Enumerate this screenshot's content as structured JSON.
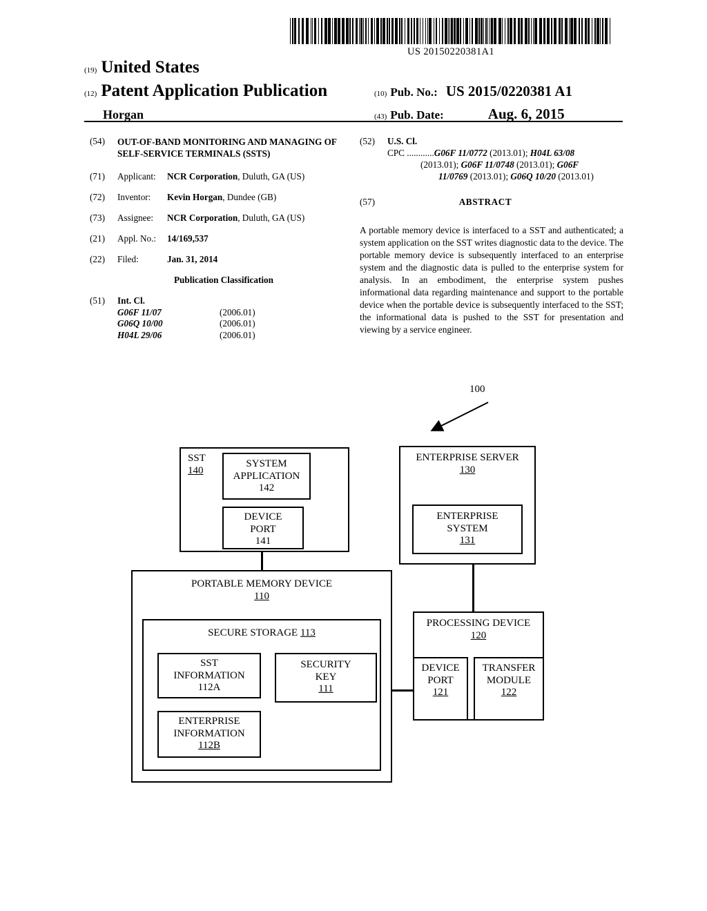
{
  "barcode": {
    "number": "US 20150220381A1"
  },
  "masthead": {
    "inid_19": "(19)",
    "country": "United States",
    "inid_12": "(12)",
    "doc_type": "Patent Application Publication",
    "author": "Horgan",
    "inid_10": "(10)",
    "pubno_label": "Pub. No.:",
    "pubno_value": "US 2015/0220381 A1",
    "inid_43": "(43)",
    "pubdate_label": "Pub. Date:",
    "pubdate_value": "Aug. 6, 2015"
  },
  "left_column": {
    "title": {
      "code": "(54)",
      "text": "OUT-OF-BAND MONITORING AND MANAGING OF SELF-SERVICE TERMINALS (SSTS)"
    },
    "applicant": {
      "code": "(71)",
      "label": "Applicant:",
      "name": "NCR Corporation",
      "rest": ", Duluth, GA (US)"
    },
    "inventor": {
      "code": "(72)",
      "label": "Inventor:",
      "name": "Kevin Horgan",
      "rest": ", Dundee (GB)"
    },
    "assignee": {
      "code": "(73)",
      "label": "Assignee:",
      "name": "NCR Corporation",
      "rest": ", Duluth, GA (US)"
    },
    "appl_no": {
      "code": "(21)",
      "label": "Appl. No.:",
      "value": "14/169,537"
    },
    "filed": {
      "code": "(22)",
      "label": "Filed:",
      "value": "Jan. 31, 2014"
    },
    "pub_class_heading": "Publication Classification",
    "int_cl": {
      "code": "(51)",
      "label": "Int. Cl.",
      "rows": [
        {
          "cls": "G06F 11/07",
          "ver": "(2006.01)"
        },
        {
          "cls": "G06Q 10/00",
          "ver": "(2006.01)"
        },
        {
          "cls": "H04L 29/06",
          "ver": "(2006.01)"
        }
      ]
    }
  },
  "right_column": {
    "us_cl": {
      "code": "(52)",
      "label": "U.S. Cl.",
      "cpc_prefix": "CPC ............",
      "line1_a": "G06F 11/0772",
      "line1_b": " (2013.01); ",
      "line1_c": "H04L 63/08",
      "line2_a": "(2013.01); ",
      "line2_b": "G06F 11/0748",
      "line2_c": " (2013.01); ",
      "line2_d": "G06F",
      "line3_a": "11/0769",
      "line3_b": " (2013.01); ",
      "line3_c": "G06Q 10/20",
      "line3_d": " (2013.01)"
    },
    "abstract": {
      "code": "(57)",
      "heading": "ABSTRACT",
      "text": "A portable memory device is interfaced to a SST and authenticated; a system application on the SST writes diagnostic data to the device. The portable memory device is subsequently interfaced to an enterprise system and the diagnostic data is pulled to the enterprise system for analysis. In an embodiment, the enterprise system pushes informational data regarding maintenance and support to the portable device when the portable device is subsequently interfaced to the SST; the informational data is pushed to the SST for presentation and viewing by a service engineer."
    }
  },
  "figure": {
    "ref_label": "100",
    "boxes": {
      "sst": {
        "title": "SST",
        "num": "140"
      },
      "system_application": {
        "title": "SYSTEM APPLICATION",
        "num": "142"
      },
      "device_port_141": {
        "title": "DEVICE PORT",
        "num": "141"
      },
      "enterprise_server": {
        "title": "ENTERPRISE SERVER",
        "num": "130"
      },
      "enterprise_system": {
        "title": "ENTERPRISE SYSTEM",
        "num": "131"
      },
      "portable_memory_device": {
        "title": "PORTABLE MEMORY DEVICE",
        "num": "110"
      },
      "secure_storage": {
        "title": "SECURE STORAGE",
        "num": "113"
      },
      "sst_information": {
        "title": "SST INFORMATION",
        "num": "112A"
      },
      "security_key": {
        "title": "SECURITY KEY",
        "num": "111"
      },
      "enterprise_information": {
        "title": "ENTERPRISE INFORMATION",
        "num": "112B"
      },
      "processing_device": {
        "title": "PROCESSING DEVICE",
        "num": "120"
      },
      "device_port_121": {
        "title": "DEVICE PORT",
        "num": "121"
      },
      "transfer_module": {
        "title": "TRANSFER MODULE",
        "num": "122"
      }
    }
  }
}
